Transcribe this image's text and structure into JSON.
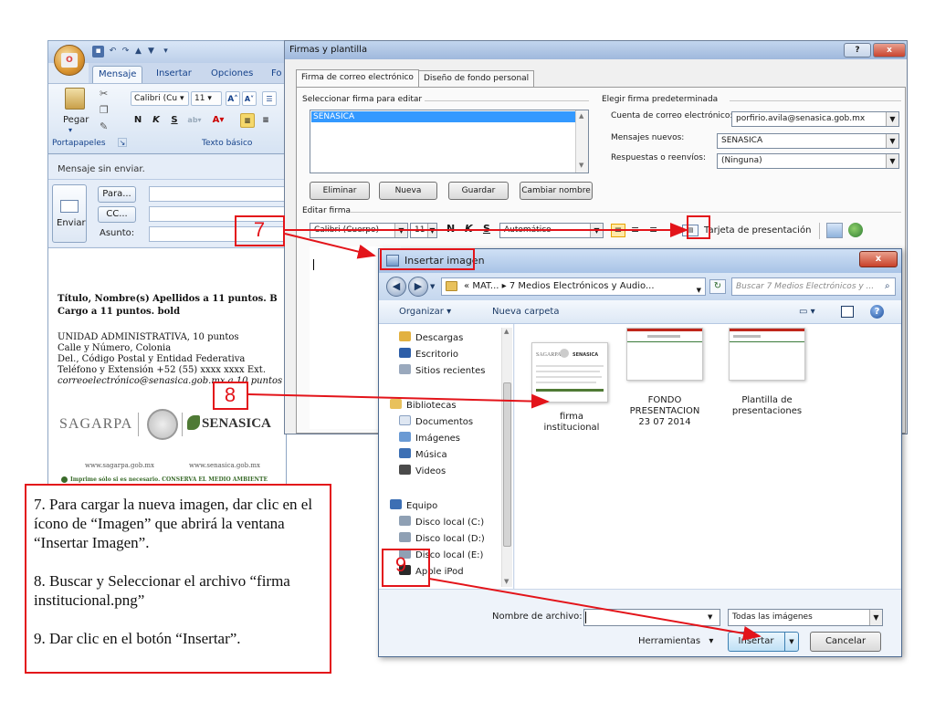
{
  "outlook": {
    "tabs": [
      "Mensaje",
      "Insertar",
      "Opciones",
      "Fo"
    ],
    "font_name": "Calibri (Cu",
    "font_size": "11",
    "paste_label": "Pegar",
    "group_clipboard": "Portapapeles",
    "group_basic_text": "Texto básico",
    "bold": "N",
    "italic": "K",
    "underline": "S",
    "not_sent": "Mensaje sin enviar.",
    "send": "Enviar",
    "to": "Para...",
    "cc": "CC...",
    "subject": "Asunto:",
    "signature_lines": [
      "Título, Nombre(s) Apellidos a 11 puntos. B",
      "Cargo a 11 puntos. bold",
      "UNIDAD ADMINISTRATIVA, 10 puntos",
      "Calle y Número, Colonia",
      "Del., Código Postal y Entidad Federativa",
      "Teléfono y Extensión +52 (55) xxxx xxxx Ext.",
      "correoelectrónico@senasica.gob.mx a 10 puntos"
    ],
    "logo_sagarpa": "SAGARPA",
    "logo_senasica": "SENASICA",
    "website_sagarpa": "www.sagarpa.gob.mx",
    "website_senasica": "www.senasica.gob.mx",
    "footer": "Imprime sólo si es necesario. CONSERVA EL MEDIO AMBIENTE"
  },
  "firmas": {
    "title": "Firmas y plantilla",
    "tab_firma": "Firma de correo electrónico",
    "tab_diseno": "Diseño de fondo personal",
    "select_label": "Seleccionar firma para editar",
    "signature_item": "SENASICA",
    "default_label": "Elegir firma predeterminada",
    "account_label": "Cuenta de correo electrónico:",
    "account_value": "porfirio.avila@senasica.gob.mx",
    "new_label": "Mensajes nuevos:",
    "new_value": "SENASICA",
    "reply_label": "Respuestas o reenvíos:",
    "reply_value": "(Ninguna)",
    "btn_delete": "Eliminar",
    "btn_new": "Nueva",
    "btn_save": "Guardar",
    "btn_rename": "Cambiar nombre",
    "edit_label": "Editar firma",
    "edit_font": "Calibri (Cuerpo)",
    "edit_size": "11",
    "edit_color": "Automático",
    "business_card": "Tarjeta de presentación",
    "help": "?",
    "close": "x"
  },
  "insertar": {
    "title": "Insertar imagen",
    "close": "x",
    "path_prefix": "«",
    "path_1": "MAT...",
    "path_2": "7 Medios Electrónicos y Audio...",
    "search_placeholder": "Buscar 7 Medios Electrónicos y ...",
    "organize": "Organizar",
    "new_folder": "Nueva carpeta",
    "nav_items": [
      "Descargas",
      "Escritorio",
      "Sitios recientes",
      "Bibliotecas",
      "Documentos",
      "Imágenes",
      "Música",
      "Videos",
      "Equipo",
      "Disco local (C:)",
      "Disco local (D:)",
      "Disco local (E:)",
      "Apple iPod"
    ],
    "files": [
      {
        "line1": "firma",
        "line2": "institucional",
        "line3": ""
      },
      {
        "line1": "FONDO",
        "line2": "PRESENTACION",
        "line3": "23 07 2014"
      },
      {
        "line1": "Plantilla de",
        "line2": "presentaciones",
        "line3": ""
      }
    ],
    "thumb_sagarpa": "SAGARPA",
    "thumb_senasica": "SENASICA",
    "filename_label": "Nombre de archivo:",
    "filename_value": "",
    "filter": "Todas las imágenes",
    "tools": "Herramientas",
    "insert": "Insertar",
    "cancel": "Cancelar"
  },
  "annotations": {
    "n7": "7",
    "n8": "8",
    "n9": "9",
    "note_7": "7. Para cargar la nueva imagen, dar clic en el ícono de “Imagen” que abrirá la ventana “Insertar Imagen”.",
    "note_8": "8. Buscar y Seleccionar el archivo “firma institucional.png”",
    "note_9": "9. Dar clic en el botón “Insertar”.",
    "color": "#e3141a"
  }
}
